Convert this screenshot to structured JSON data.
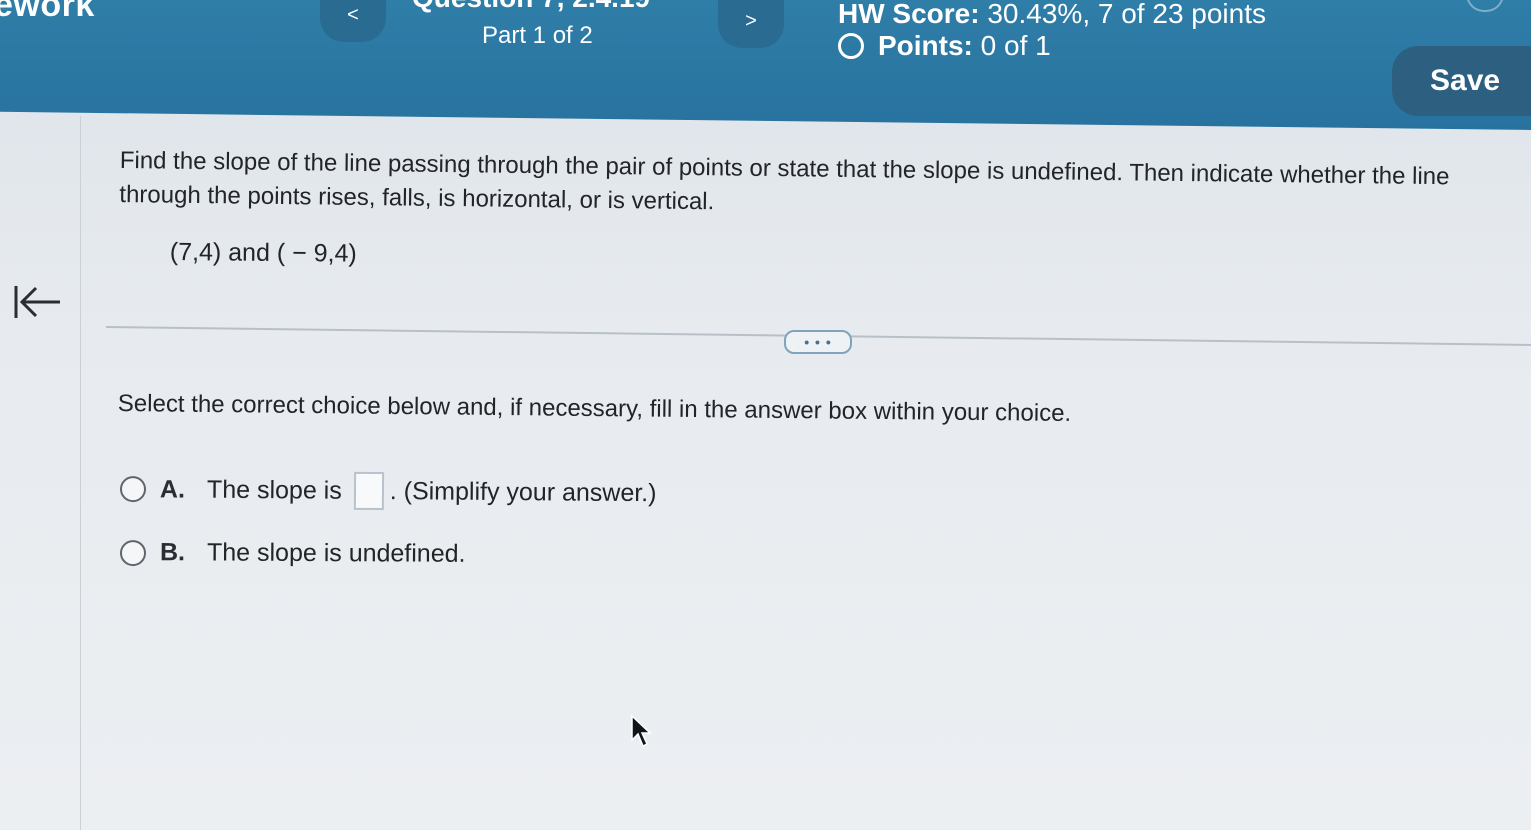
{
  "header": {
    "app_title": "ework",
    "question_title": "Question 7, 2.4.19",
    "part_label": "Part 1 of 2",
    "hw_score_label": "HW Score:",
    "hw_score_value": "30.43%, 7 of 23 points",
    "points_label": "Points:",
    "points_value": "0 of 1",
    "save_label": "Save",
    "prev_glyph": "<",
    "next_glyph": ">"
  },
  "question": {
    "prompt": "Find the slope of the line passing through the pair of points or state that the slope is undefined. Then indicate whether the line through the points rises, falls, is horizontal, or is vertical.",
    "points": "(7,4) and ( − 9,4)"
  },
  "more_button": "• • •",
  "instruction": "Select the correct choice below and, if necessary, fill in the answer box within your choice.",
  "choices": [
    {
      "letter": "A.",
      "text_before": "The slope is",
      "text_after": ". (Simplify your answer.)",
      "answer_value": ""
    },
    {
      "letter": "B.",
      "text": "The slope is undefined."
    }
  ],
  "icons": {
    "collapse": "arrow-to-left-icon",
    "pointer": "mouse-pointer-icon",
    "points_status": "circle-outline-icon"
  },
  "colors": {
    "header_blue": "#2f7ea8",
    "save_button": "#2c5f80",
    "text_dark": "#222428",
    "page_background": "#e7ebef"
  }
}
